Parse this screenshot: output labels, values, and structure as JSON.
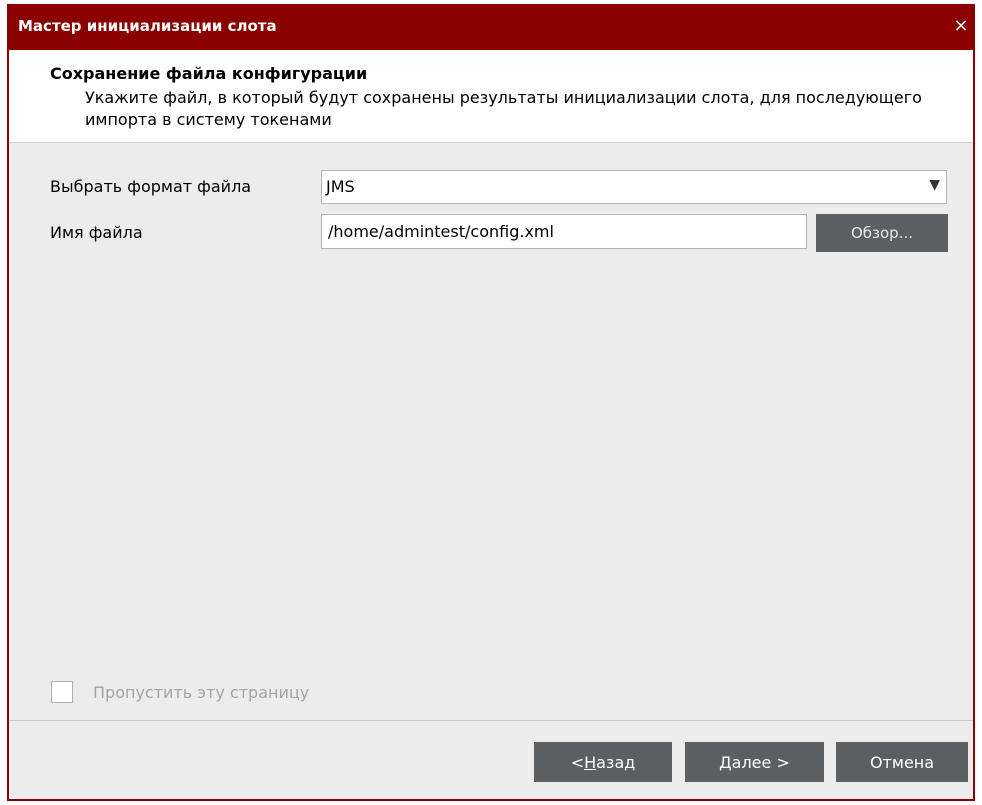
{
  "window": {
    "title": "Мастер инициализации слота",
    "close_glyph": "×"
  },
  "header": {
    "title": "Сохранение файла конфигурации",
    "description": "Укажите файл, в который будут сохранены результаты инициализации слота, для последующего импорта в систему токенами"
  },
  "form": {
    "format_label": "Выбрать формат файла",
    "format_value": "JMS",
    "dropdown_glyph": "▼",
    "filename_label": "Имя файла",
    "filename_value": "/home/admintest/config.xml",
    "browse_label": "Обзор..."
  },
  "skip": {
    "label": "Пропустить эту страницу",
    "checked": false
  },
  "buttons": {
    "back_prefix": "< ",
    "back_mnemonic": "Н",
    "back_rest": "азад",
    "next_mnemonic": "Д",
    "next_rest": "алее >",
    "cancel": "Отмена"
  },
  "colors": {
    "titlebar": "#8b0000",
    "button": "#5c5f62",
    "panel": "#ececec"
  },
  "icons": {
    "close": "close-icon",
    "dropdown": "chevron-down-icon"
  }
}
